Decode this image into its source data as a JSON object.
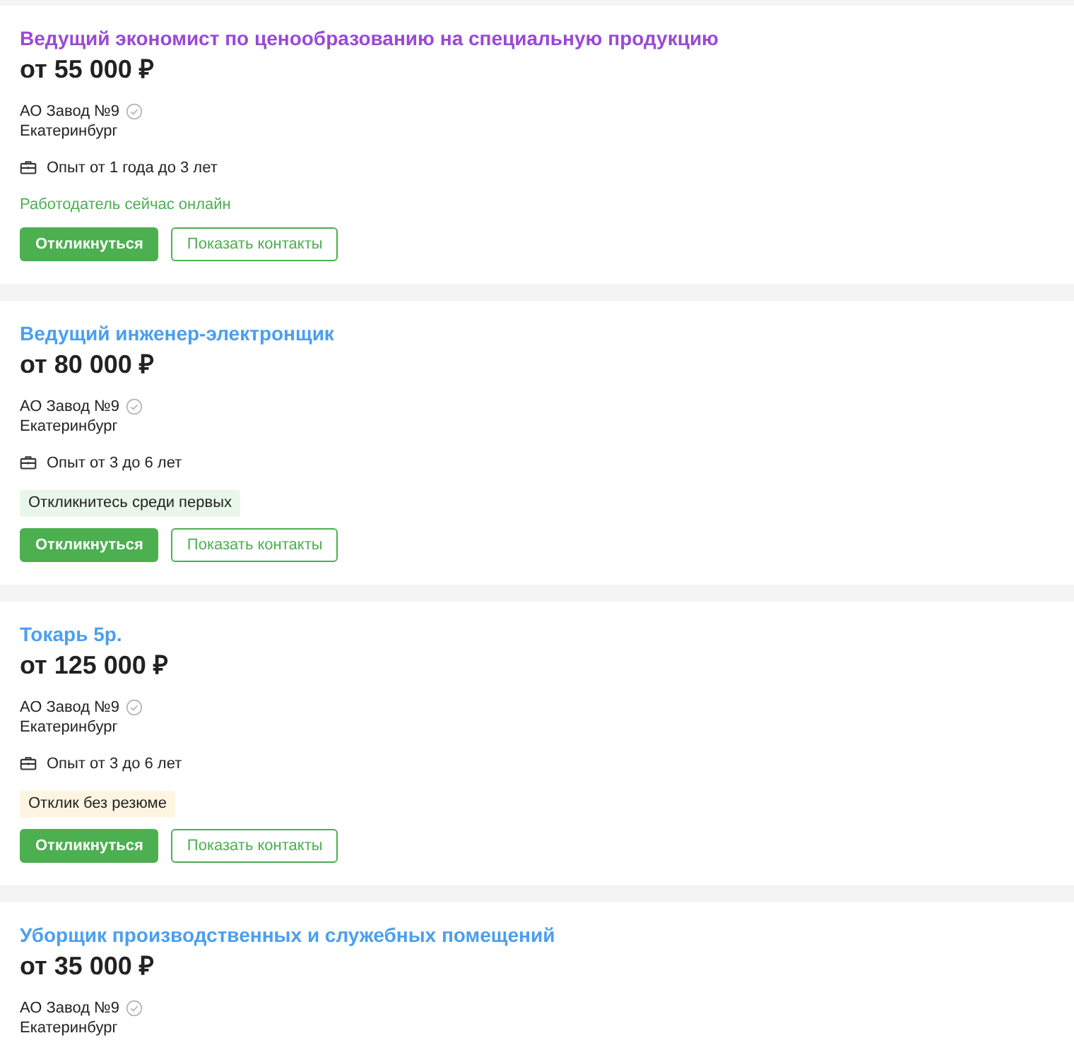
{
  "vacancies": [
    {
      "title": "Ведущий экономист по ценообразованию на специальную продукцию",
      "visited": true,
      "salary": "от 55 000 ₽",
      "company": "АО Завод №9",
      "verified": true,
      "city": "Екатеринбург",
      "experience": "Опыт от 1 года до 3 лет",
      "badge": {
        "kind": "online",
        "text": "Работодатель сейчас онлайн"
      },
      "buttons": [
        "Откликнуться",
        "Показать контакты"
      ]
    },
    {
      "title": "Ведущий инженер-электронщик",
      "visited": false,
      "salary": "от 80 000 ₽",
      "company": "АО Завод №9",
      "verified": true,
      "city": "Екатеринбург",
      "experience": "Опыт от 3 до 6 лет",
      "badge": {
        "kind": "first",
        "text": "Откликнитесь среди первых"
      },
      "buttons": [
        "Откликнуться",
        "Показать контакты"
      ]
    },
    {
      "title": "Токарь 5р.",
      "visited": false,
      "salary": "от 125 000 ₽",
      "company": "АО Завод №9",
      "verified": true,
      "city": "Екатеринбург",
      "experience": "Опыт от 3 до 6 лет",
      "badge": {
        "kind": "noresume",
        "text": "Отклик без резюме"
      },
      "buttons": [
        "Откликнуться",
        "Показать контакты"
      ]
    },
    {
      "title": "Уборщик производственных и служебных помещений",
      "visited": false,
      "salary": "от 35 000 ₽",
      "company": "АО Завод №9",
      "verified": true,
      "city": "Екатеринбург"
    }
  ]
}
